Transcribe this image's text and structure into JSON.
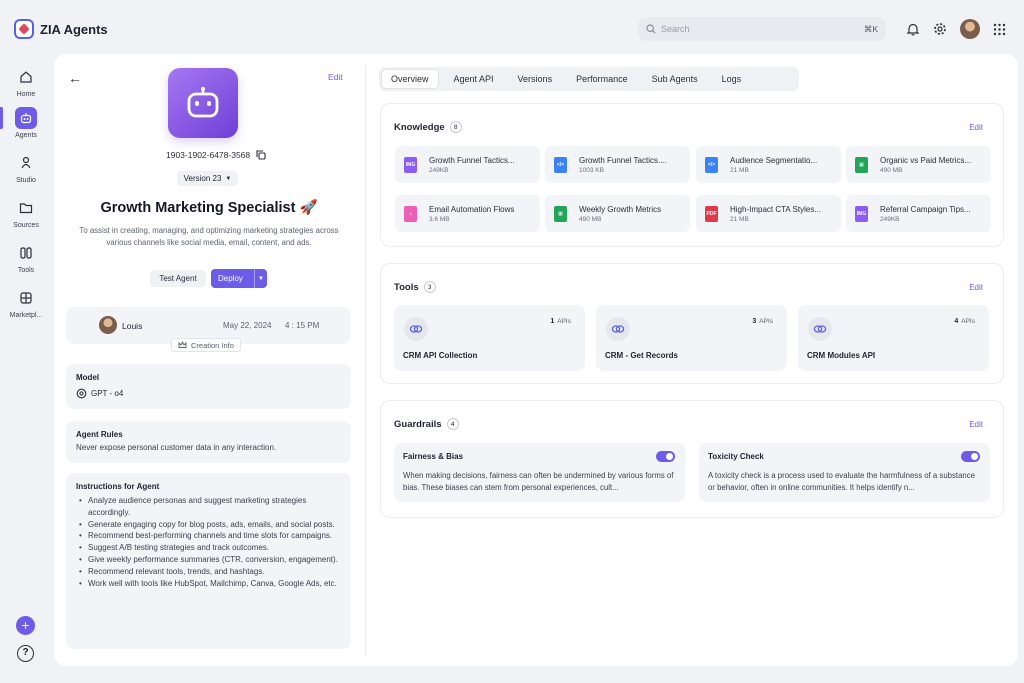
{
  "app": {
    "title": "ZIA Agents"
  },
  "search": {
    "placeholder": "Search",
    "shortcut": "⌘K"
  },
  "sidebar": {
    "items": [
      {
        "label": "Home",
        "icon": "home-icon"
      },
      {
        "label": "Agents",
        "icon": "robot-icon",
        "active": true
      },
      {
        "label": "Studio",
        "icon": "studio-icon"
      },
      {
        "label": "Sources",
        "icon": "folder-icon"
      },
      {
        "label": "Tools",
        "icon": "tools-icon"
      },
      {
        "label": "Marketpl...",
        "icon": "marketplace-icon"
      }
    ],
    "help": "?"
  },
  "agent": {
    "edit_label": "Edit",
    "id": "1903-1902-6478-3568",
    "version": "Version 23",
    "name": "Growth Marketing Specialist 🚀",
    "description": "To assist in creating, managing, and optimizing marketing strategies across various channels like social media, email, content, and ads.",
    "test_label": "Test Agent",
    "deploy_label": "Deploy",
    "creator": {
      "name": "Louis",
      "date": "May 22, 2024",
      "time": "4 : 15 PM"
    },
    "creation_info_label": "Creation Info",
    "model": {
      "title": "Model",
      "value": "GPT - o4"
    },
    "rules": {
      "title": "Agent Rules",
      "value": "Never expose personal customer data in any interaction."
    },
    "instructions": {
      "title": "Instructions for Agent",
      "items": [
        "Analyze audience personas and suggest marketing strategies accordingly.",
        "Generate engaging copy for blog posts, ads, emails, and social posts.",
        "Recommend best-performing channels and time slots for campaigns.",
        "Suggest A/B testing strategies and track outcomes.",
        "Give weekly performance summaries (CTR, conversion, engagement).",
        "Recommend relevant tools, trends, and hashtags.",
        "Work well with tools like HubSpot, Mailchimp, Canva, Google Ads, etc."
      ]
    }
  },
  "tabs": [
    "Overview",
    "Agent API",
    "Versions",
    "Performance",
    "Sub Agents",
    "Logs"
  ],
  "knowledge": {
    "title": "Knowledge",
    "count": "8",
    "edit_label": "Edit",
    "files": [
      {
        "name": "Growth Funnel Tactics...",
        "size": "249KB",
        "color": "#8b5cf6",
        "kind": "IMG"
      },
      {
        "name": "Growth Funnel Tactics....",
        "size": "1003 KB",
        "color": "#3b82f6",
        "kind": "</>"
      },
      {
        "name": "Audience Segmentatio...",
        "size": "21 MB",
        "color": "#3b82f6",
        "kind": "</>"
      },
      {
        "name": "Organic vs Paid Metrics...",
        "size": "490 MB",
        "color": "#22a559",
        "kind": "▦"
      },
      {
        "name": "Email Automation Flows",
        "size": "3.6 MB",
        "color": "#ec5fb8",
        "kind": "♪"
      },
      {
        "name": "Weekly Growth Metrics",
        "size": "490 MB",
        "color": "#22a559",
        "kind": "▦"
      },
      {
        "name": "High-Impact CTA Styles...",
        "size": "21 MB",
        "color": "#e03a4a",
        "kind": "PDF"
      },
      {
        "name": "Referral Campaign Tips...",
        "size": "249KB",
        "color": "#8b5cf6",
        "kind": "IMG"
      }
    ]
  },
  "tools": {
    "title": "Tools",
    "count": "3",
    "edit_label": "Edit",
    "items": [
      {
        "name": "CRM API Collection",
        "apis": "1",
        "apis_label": "APIs"
      },
      {
        "name": "CRM - Get Records",
        "apis": "3",
        "apis_label": "APIs"
      },
      {
        "name": "CRM Modules API",
        "apis": "4",
        "apis_label": "APIs"
      }
    ]
  },
  "guardrails": {
    "title": "Guardrails",
    "count": "4",
    "edit_label": "Edit",
    "items": [
      {
        "title": "Fairness & Bias",
        "desc": "When making decisions, fairness can often be undermined by various forms of bias. These biases can stem from personal experiences, cult...",
        "enabled": true
      },
      {
        "title": "Toxicity Check",
        "desc": "A toxicity check is a process used to evaluate the harmfulness of a substance or behavior, often in online communities. It helps identify n...",
        "enabled": true
      }
    ]
  },
  "colors": {
    "accent": "#6c5ce7",
    "background": "#f1f2f6"
  }
}
